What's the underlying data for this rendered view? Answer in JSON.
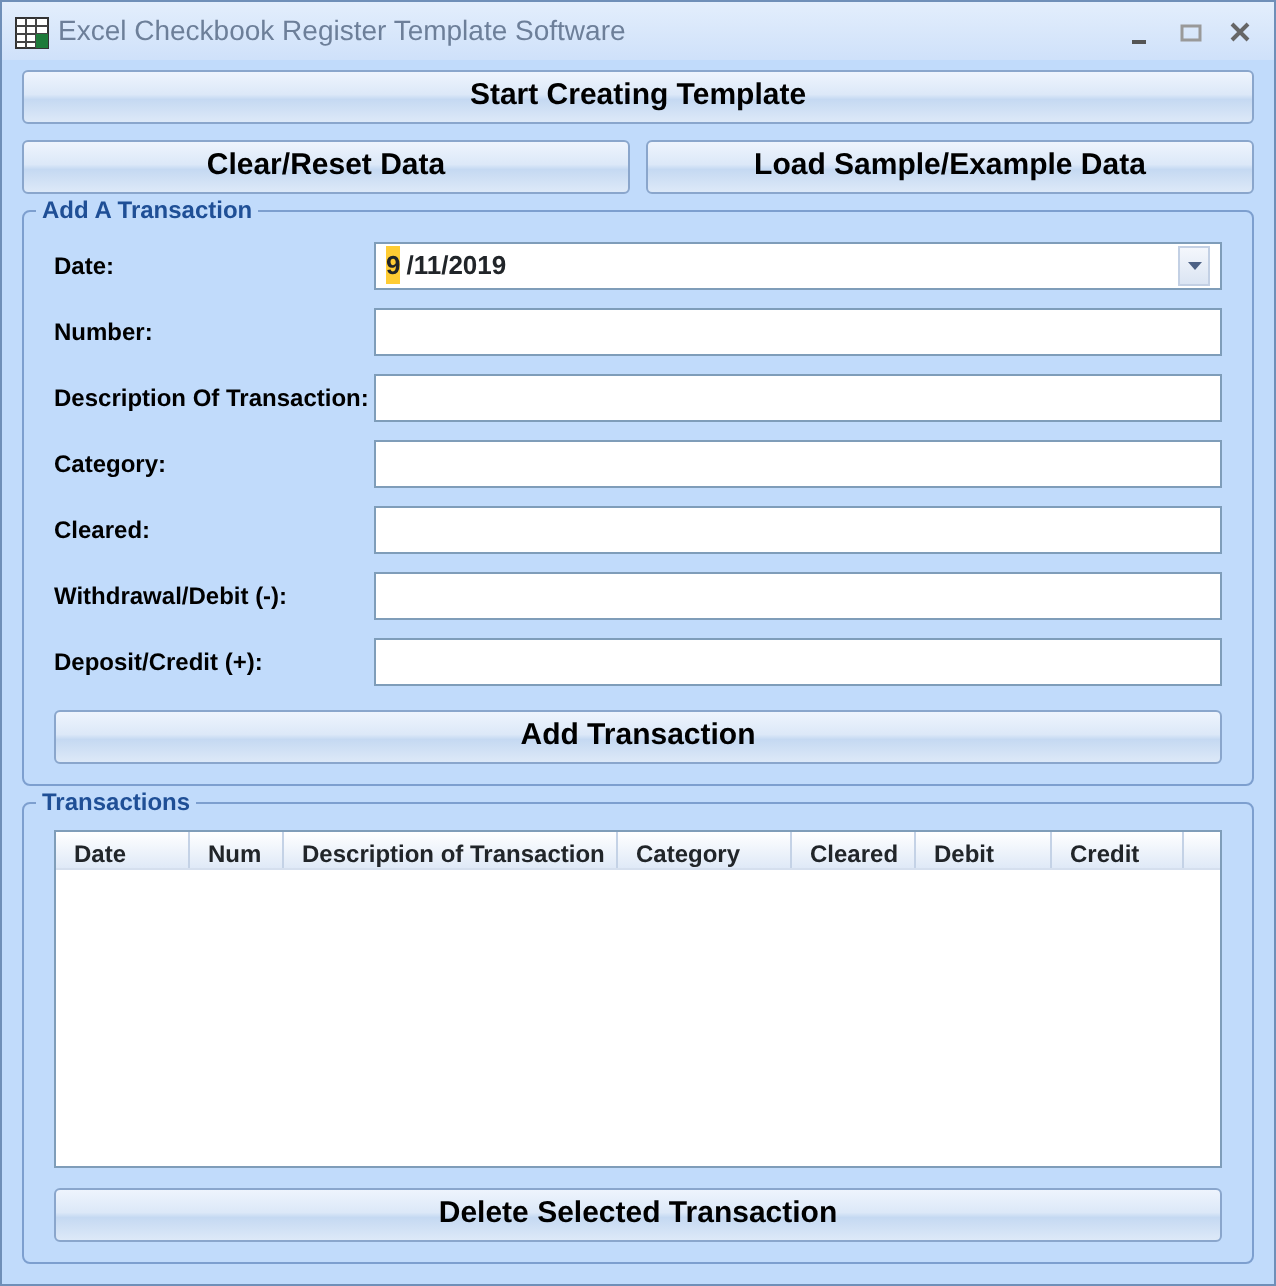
{
  "window": {
    "title": "Excel Checkbook Register Template Software"
  },
  "top_buttons": [
    [
      "Start Creating Template"
    ],
    [
      "Clear/Reset Data",
      "Load Sample/Example Data"
    ]
  ],
  "add_group": {
    "title": "Add A Transaction",
    "fields": [
      {
        "label": "Date:",
        "kind": "date",
        "segments": [
          {
            "text": "9",
            "selected": true
          },
          {
            "text": "/11/2019",
            "selected": false
          }
        ]
      },
      {
        "label": "Number:",
        "kind": "text"
      },
      {
        "label": "Description Of Transaction:",
        "kind": "text"
      },
      {
        "label": "Category:",
        "kind": "text"
      },
      {
        "label": "Cleared:",
        "kind": "text"
      },
      {
        "label": "Withdrawal/Debit (-):",
        "kind": "text"
      },
      {
        "label": "Deposit/Credit (+):",
        "kind": "text"
      }
    ],
    "button": "Add Transaction"
  },
  "transactions_group": {
    "title": "Transactions",
    "table": {
      "columns": [
        {
          "label": "Date"
        },
        {
          "label": "Num"
        },
        {
          "label": "Description of Transaction"
        },
        {
          "label": "Category"
        },
        {
          "label": "Cleared"
        },
        {
          "label": "Debit"
        },
        {
          "label": "Credit"
        }
      ]
    },
    "button": "Delete Selected Transaction"
  }
}
